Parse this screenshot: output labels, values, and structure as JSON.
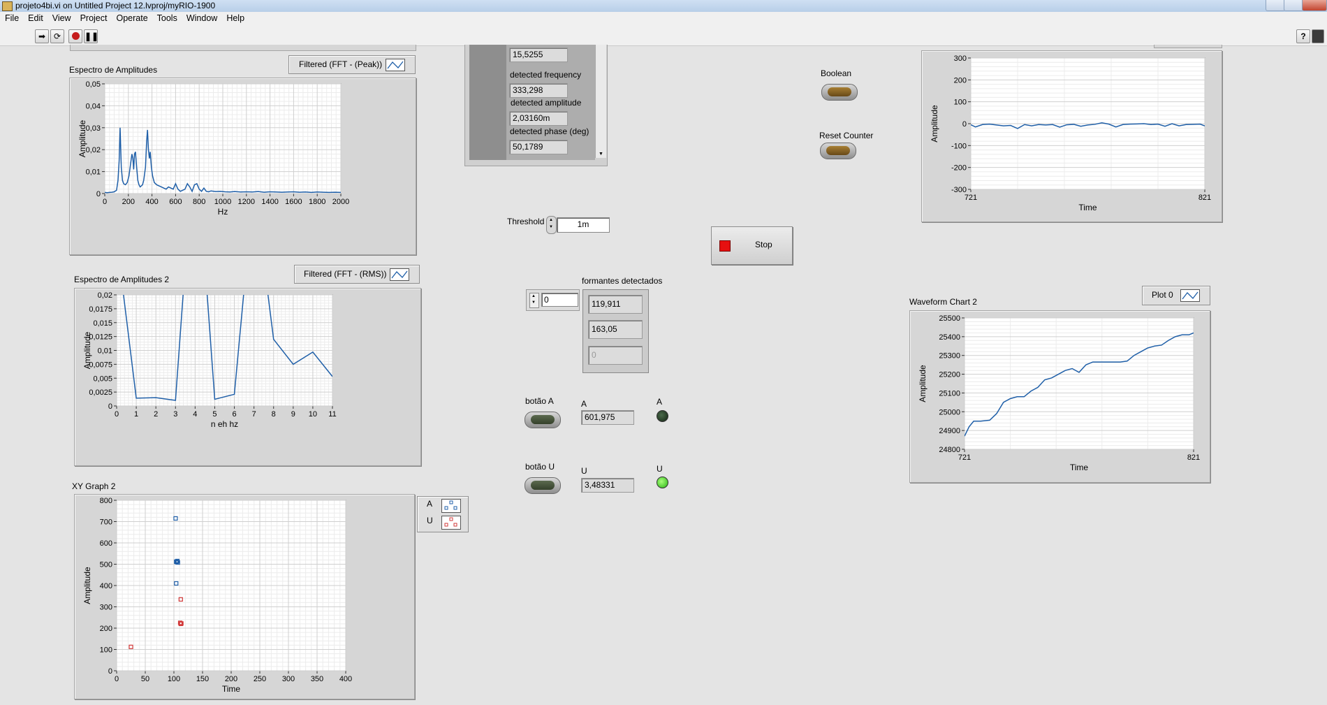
{
  "window": {
    "title": "projeto4bi.vi on Untitled Project 12.lvproj/myRIO-1900",
    "title_suffix": "/myRIO-1900"
  },
  "menu": [
    "File",
    "Edit",
    "View",
    "Project",
    "Operate",
    "Tools",
    "Window",
    "Help"
  ],
  "toolbar": {
    "run": "run-arrow-icon",
    "run_continuously": "run-continuously-icon",
    "abort": "abort-icon",
    "pause": "pause-icon",
    "help": "?"
  },
  "graph1": {
    "title": "Espectro de Amplitudes",
    "legend": "Filtered (FFT - (Peak))"
  },
  "graph2": {
    "title": "Espectro de Amplitudes 2",
    "legend": "Filtered (FFT - (RMS))"
  },
  "xy": {
    "title": "XY Graph 2",
    "legend": [
      "A",
      "U"
    ]
  },
  "cluster": {
    "items": [
      {
        "value": "15,5255"
      },
      {
        "label": "detected frequency",
        "value": "333,298"
      },
      {
        "label": "detected amplitude",
        "value": "2,03160m"
      },
      {
        "label": "detected phase (deg)",
        "value": "50,1789"
      }
    ]
  },
  "threshold": {
    "label": "Threshold",
    "value": "1m"
  },
  "formantes": {
    "label": "formantes detectados",
    "index": "0",
    "values": [
      "119,911",
      "163,05",
      "0"
    ]
  },
  "buttonA": {
    "label": "botão A",
    "ind_label": "A",
    "value": "601,975",
    "led_label": "A",
    "led_state": "off"
  },
  "buttonU": {
    "label": "botão U",
    "ind_label": "U",
    "value": "3,48331",
    "led_label": "U",
    "led_state": "on"
  },
  "boolean": {
    "label": "Boolean"
  },
  "reset": {
    "label": "Reset Counter"
  },
  "stop": {
    "label": "Stop"
  },
  "chart1": {
    "title": ""
  },
  "chart2": {
    "title": "Waveform Chart 2",
    "legend": "Plot 0"
  },
  "colors": {
    "plot_blue": "#1f5fa8",
    "plot_red": "#d23a3a",
    "panel_bg": "#e4e4e4"
  },
  "chart_data": [
    {
      "type": "line",
      "id": "espectro1",
      "title": "Espectro de Amplitudes",
      "xlabel": "Hz",
      "ylabel": "Amplitude",
      "xlim": [
        0,
        2000
      ],
      "ylim": [
        0,
        0.05
      ],
      "xticks": [
        0,
        200,
        400,
        600,
        800,
        1000,
        1200,
        1400,
        1600,
        1800,
        2000
      ],
      "xtick_labels": [
        "0",
        "200",
        "400",
        "600",
        "800",
        "1000",
        "1200",
        "1400",
        "1600",
        "1800",
        "2000"
      ],
      "yticks": [
        0,
        0.01,
        0.02,
        0.03,
        0.04,
        0.05
      ],
      "ytick_labels": [
        "0",
        "0,01",
        "0,02",
        "0,03",
        "0,04",
        "0,05"
      ],
      "series": [
        {
          "x": [
            0,
            20,
            40,
            60,
            80,
            100,
            112,
            122,
            130,
            140,
            150,
            160,
            175,
            190,
            205,
            220,
            230,
            238,
            245,
            252,
            260,
            270,
            280,
            290,
            300,
            310,
            320,
            330,
            345,
            355,
            362,
            370,
            378,
            385,
            395,
            405,
            420,
            440,
            460,
            480,
            500,
            520,
            540,
            560,
            580,
            600,
            620,
            640,
            660,
            680,
            700,
            720,
            740,
            760,
            780,
            800,
            820,
            840,
            860,
            880,
            900,
            940,
            980,
            1020,
            1060,
            1100,
            1150,
            1200,
            1250,
            1300,
            1350,
            1400,
            1450,
            1500,
            1550,
            1600,
            1650,
            1700,
            1750,
            1800,
            1850,
            1900,
            1950,
            2000
          ],
          "y": [
            0.0005,
            0.0004,
            0.0005,
            0.0006,
            0.0008,
            0.0015,
            0.006,
            0.015,
            0.03,
            0.012,
            0.006,
            0.0045,
            0.004,
            0.005,
            0.008,
            0.014,
            0.018,
            0.016,
            0.011,
            0.018,
            0.019,
            0.012,
            0.006,
            0.004,
            0.003,
            0.0035,
            0.004,
            0.006,
            0.012,
            0.024,
            0.029,
            0.02,
            0.016,
            0.019,
            0.012,
            0.008,
            0.005,
            0.004,
            0.0035,
            0.003,
            0.0025,
            0.002,
            0.003,
            0.0025,
            0.002,
            0.0045,
            0.002,
            0.001,
            0.0015,
            0.002,
            0.0045,
            0.003,
            0.001,
            0.004,
            0.0045,
            0.002,
            0.001,
            0.0025,
            0.001,
            0.0008,
            0.0012,
            0.0009,
            0.001,
            0.0008,
            0.0007,
            0.0009,
            0.0007,
            0.0008,
            0.0007,
            0.0009,
            0.0006,
            0.0008,
            0.0007,
            0.0006,
            0.0007,
            0.0008,
            0.0006,
            0.0007,
            0.0005,
            0.0007,
            0.0006,
            0.0005,
            0.0006,
            0.0005
          ]
        }
      ]
    },
    {
      "type": "line",
      "id": "espectro2",
      "title": "Espectro de Amplitudes 2",
      "xlabel": "n eh hz",
      "ylabel": "Amplitude",
      "xlim": [
        0,
        11
      ],
      "ylim": [
        0,
        0.02
      ],
      "xticks": [
        0,
        1,
        2,
        3,
        4,
        5,
        6,
        7,
        8,
        9,
        10,
        11
      ],
      "xtick_labels": [
        "0",
        "1",
        "2",
        "3",
        "4",
        "5",
        "6",
        "7",
        "8",
        "9",
        "10",
        "11"
      ],
      "yticks": [
        0,
        0.0025,
        0.005,
        0.0075,
        0.01,
        0.0125,
        0.015,
        0.0175,
        0.02
      ],
      "ytick_labels": [
        "0",
        "0,0025",
        "0,005",
        "0,0075",
        "0,01",
        "0,0125",
        "0,015",
        "0,0175",
        "0,02"
      ],
      "series": [
        {
          "x": [
            0,
            1,
            2,
            3,
            4,
            5,
            6,
            7,
            8,
            9,
            10,
            11
          ],
          "y": [
            0.03,
            0.0014,
            0.0015,
            0.001,
            0.05,
            0.0012,
            0.0021,
            0.04,
            0.012,
            0.0075,
            0.0097,
            0.0053
          ]
        }
      ]
    },
    {
      "type": "scatter",
      "id": "xy2",
      "title": "XY Graph 2",
      "xlabel": "Time",
      "ylabel": "Amplitude",
      "xlim": [
        0,
        400
      ],
      "ylim": [
        0,
        800
      ],
      "xticks": [
        0,
        50,
        100,
        150,
        200,
        250,
        300,
        350,
        400
      ],
      "xtick_labels": [
        "0",
        "50",
        "100",
        "150",
        "200",
        "250",
        "300",
        "350",
        "400"
      ],
      "yticks": [
        0,
        100,
        200,
        300,
        400,
        500,
        600,
        700,
        800
      ],
      "ytick_labels": [
        "0",
        "100",
        "200",
        "300",
        "400",
        "500",
        "600",
        "700",
        "800"
      ],
      "series": [
        {
          "name": "A",
          "x": [
            103,
            105,
            104,
            106,
            107,
            104
          ],
          "y": [
            715,
            510,
            512,
            515,
            508,
            410
          ]
        },
        {
          "name": "U",
          "x": [
            25,
            112,
            113,
            111,
            112
          ],
          "y": [
            112,
            335,
            222,
            225,
            220
          ]
        }
      ]
    },
    {
      "type": "line",
      "id": "chart1",
      "xlabel": "Time",
      "ylabel": "Amplitude",
      "xlim": [
        721,
        821
      ],
      "ylim": [
        -300,
        300
      ],
      "xticks": [
        721,
        821
      ],
      "xtick_labels": [
        "721",
        "821"
      ],
      "yticks": [
        -300,
        -200,
        -100,
        0,
        100,
        200,
        300
      ],
      "ytick_labels": [
        "-300",
        "-200",
        "-100",
        "0",
        "100",
        "200",
        "300"
      ],
      "series": [
        {
          "x": [
            721,
            723,
            726,
            729,
            732,
            735,
            738,
            741,
            744,
            747,
            750,
            753,
            756,
            759,
            762,
            765,
            768,
            771,
            774,
            777,
            780,
            783,
            786,
            789,
            792,
            795,
            798,
            801,
            804,
            807,
            810,
            813,
            816,
            819,
            821
          ],
          "y": [
            -5,
            -15,
            -4,
            -2,
            -6,
            -10,
            -8,
            -22,
            -4,
            -10,
            -4,
            -6,
            -4,
            -16,
            -5,
            -3,
            -12,
            -6,
            -3,
            4,
            -2,
            -15,
            -4,
            -2,
            -1,
            0,
            -4,
            -2,
            -12,
            0,
            -10,
            -4,
            -3,
            -2,
            -10
          ]
        }
      ]
    },
    {
      "type": "line",
      "id": "chart2",
      "title": "Waveform Chart 2",
      "xlabel": "Time",
      "ylabel": "Amplitude",
      "xlim": [
        721,
        821
      ],
      "ylim": [
        24800,
        25500
      ],
      "xticks": [
        721,
        821
      ],
      "xtick_labels": [
        "721",
        "821"
      ],
      "yticks": [
        24800,
        24900,
        25000,
        25100,
        25200,
        25300,
        25400,
        25500
      ],
      "ytick_labels": [
        "24800",
        "24900",
        "25000",
        "25100",
        "25200",
        "25300",
        "25400",
        "25500"
      ],
      "series": [
        {
          "name": "Plot 0",
          "x": [
            721,
            723,
            725,
            728,
            732,
            735,
            738,
            741,
            744,
            747,
            750,
            753,
            756,
            759,
            762,
            765,
            768,
            771,
            774,
            777,
            780,
            783,
            786,
            789,
            792,
            795,
            798,
            801,
            804,
            807,
            810,
            813,
            816,
            819,
            821
          ],
          "y": [
            24870,
            24920,
            24950,
            24950,
            24955,
            24990,
            25050,
            25070,
            25080,
            25080,
            25110,
            25130,
            25170,
            25180,
            25200,
            25220,
            25230,
            25210,
            25250,
            25265,
            25265,
            25265,
            25265,
            25265,
            25270,
            25300,
            25320,
            25340,
            25350,
            25355,
            25380,
            25400,
            25410,
            25410,
            25420
          ]
        }
      ]
    }
  ]
}
